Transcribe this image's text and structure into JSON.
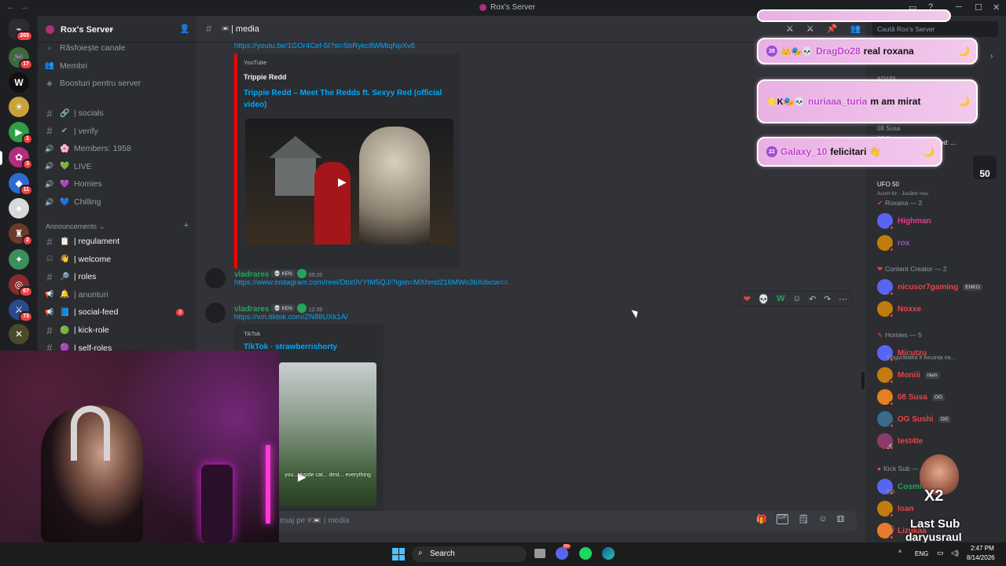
{
  "title_bar": {
    "server_title": "Rox's Server",
    "back_arrow": "←",
    "forward_arrow": "→",
    "minimize": "─",
    "maximize": "☐",
    "close": "✕"
  },
  "rail": {
    "servers": [
      {
        "name": "Discord home",
        "badge": "265",
        "color": "#2b2d31",
        "glyph": "⌁"
      },
      {
        "name": "Server 1",
        "badge": "17",
        "color": "#3b6b3b",
        "glyph": "🎮"
      },
      {
        "name": "Server W",
        "badge": "",
        "color": "#111111",
        "glyph": "W"
      },
      {
        "name": "Server 3",
        "badge": "",
        "color": "#c9a23a",
        "glyph": "☀"
      },
      {
        "name": "Server 4",
        "badge": "1",
        "color": "#2f9e44",
        "glyph": "▶"
      },
      {
        "name": "Rox's Server",
        "badge": "3",
        "color": "#b02e7b",
        "glyph": "✿"
      },
      {
        "name": "Server 6",
        "badge": "11",
        "color": "#2e6bd1",
        "glyph": "◆"
      },
      {
        "name": "Server 7",
        "badge": "",
        "color": "#d9d9d9",
        "glyph": "●"
      },
      {
        "name": "Server 8",
        "badge": "2",
        "color": "#6b3b2a",
        "glyph": "♜"
      },
      {
        "name": "Server 9",
        "badge": "",
        "color": "#3c8f5a",
        "glyph": "✦"
      },
      {
        "name": "Server 10",
        "badge": "67",
        "color": "#8a2a2a",
        "glyph": "◎"
      },
      {
        "name": "Server 11",
        "badge": "73",
        "color": "#2a4a8a",
        "glyph": "⚔"
      },
      {
        "name": "Server 12",
        "badge": "",
        "color": "#4a4a2a",
        "glyph": "✕"
      }
    ]
  },
  "sidebar": {
    "server_name": "Rox's Server",
    "top_items": [
      {
        "icon": "⌕",
        "label": "Răsfoiește canale"
      },
      {
        "icon": "👥",
        "label": "Membri"
      },
      {
        "icon": "◈",
        "label": "Boosturi pentru server"
      }
    ],
    "channels_top": [
      {
        "prefix": "#",
        "emoji": "🔗",
        "label": "| socials",
        "bold": false
      },
      {
        "prefix": "#",
        "emoji": "✔",
        "label": "| verify",
        "bold": false
      },
      {
        "prefix": "🔊",
        "emoji": "🌸",
        "label": "Members: 1958",
        "bold": false
      },
      {
        "prefix": "🔊",
        "emoji": "💚",
        "label": "LIVE",
        "bold": false
      },
      {
        "prefix": "🔊",
        "emoji": "💜",
        "label": "Homies",
        "bold": false
      },
      {
        "prefix": "🔊",
        "emoji": "💙",
        "label": "Chilling",
        "bold": false
      }
    ],
    "category": "Announcements",
    "category_add": "+",
    "channels_ann": [
      {
        "prefix": "#",
        "emoji": "📋",
        "label": "| regulament",
        "bold": true,
        "unread": ""
      },
      {
        "prefix": "☑",
        "emoji": "👋",
        "label": "| welcome",
        "bold": true,
        "unread": ""
      },
      {
        "prefix": "#",
        "emoji": "🔎",
        "label": "| roles",
        "bold": true,
        "unread": ""
      },
      {
        "prefix": "📢",
        "emoji": "🔔",
        "label": "| anunturi",
        "bold": false,
        "unread": ""
      },
      {
        "prefix": "📢",
        "emoji": "📘",
        "label": "| social-feed",
        "bold": true,
        "unread": "3"
      },
      {
        "prefix": "#",
        "emoji": "🟢",
        "label": "| kick-role",
        "bold": true,
        "unread": ""
      },
      {
        "prefix": "#",
        "emoji": "🟣",
        "label": "| self-roles",
        "bold": true,
        "unread": ""
      }
    ]
  },
  "chat": {
    "channel_name": "| media",
    "channel_emoji": "📼",
    "msg0_link": "https://youtu.be/1GOr4Cef-5I?si=5bRykc8WMtqNpXv8",
    "embed1": {
      "provider": "YouTube",
      "author": "Trippie Redd",
      "title": "Trippie Redd – Meet The Redds ft. Sexyy Red (official video)",
      "color": "#ff0000"
    },
    "messages": [
      {
        "user": "vladrares",
        "tag": "💀 KEN",
        "time": "09:20",
        "link": "https://www.instagram.com/reel/Dbz0VYtM5QJ/?igsh=MXhmd216MWo3bXdxcw=="
      },
      {
        "user": "vladrares",
        "tag": "💀 KEN",
        "time": "12:35",
        "link": "https://vm.tiktok.com/ZN88UXk1A/"
      }
    ],
    "embed2": {
      "provider": "TikTok",
      "title": "TikTok · strawberrishorty",
      "video_caption": "you... inside cat... dest... everything"
    },
    "reactions": [
      "❤",
      "💀",
      "W",
      "☺",
      "↶",
      "↷",
      "⋯"
    ],
    "composer_placeholder": "esaj pe #📼 | media",
    "composer_icons": [
      "🎁",
      "GIF",
      "🗒",
      "☺",
      "⚅"
    ]
  },
  "members": {
    "search_placeholder": "Caută Rox's Server",
    "activity": [
      {
        "name": "azxuta",
        "status": "",
        "time": ""
      },
      {
        "name": "Marzy Star",
        "status": "Singurătatea esta",
        "time": ""
      },
      {
        "name": "08 Susa",
        "status": "Scribblenauts Unmasked: ...",
        "time": "Acum 1h · Jucător nou"
      },
      {
        "name": "08 Susa",
        "status": "UFO 50",
        "time": "Acum 6z · Jucător nou"
      }
    ],
    "ufo_badge": "50",
    "groups": [
      {
        "title": "Roxana — 2",
        "icon": "✔",
        "items": [
          {
            "name": "Highman",
            "color": "#e03d8b",
            "tag": "",
            "sub": ""
          },
          {
            "name": "rox",
            "color": "#9b59b6",
            "tag": "",
            "sub": ""
          }
        ]
      },
      {
        "title": "Content Creator — 2",
        "icon": "❤",
        "items": [
          {
            "name": "nicusor7gaming",
            "color": "#ed4245",
            "tag": "ENKO",
            "sub": ""
          },
          {
            "name": "Noxxe",
            "color": "#ed4245",
            "tag": "",
            "sub": ""
          }
        ]
      },
      {
        "title": "Homies — 5",
        "icon": "✎",
        "items": [
          {
            "name": "Micutzu",
            "color": "#ed4245",
            "tag": "",
            "sub": "Singurătatea e locuința na..."
          },
          {
            "name": "Moniii",
            "color": "#ed4245",
            "tag": "ravn",
            "sub": ""
          },
          {
            "name": "08 Susa",
            "color": "#ed4245",
            "tag": "OG",
            "sub": ""
          },
          {
            "name": "OG Sushi",
            "color": "#ed4245",
            "tag": "OG",
            "sub": ""
          },
          {
            "name": "test4te",
            "color": "#ed4245",
            "tag": "",
            "sub": "🚀"
          }
        ]
      },
      {
        "title": "Kick Sub —",
        "icon": "●",
        "items": [
          {
            "name": "Cosmi",
            "color": "#23a55a",
            "tag": "",
            "sub": "kys"
          },
          {
            "name": "Ioan",
            "color": "#ed4245",
            "tag": "",
            "sub": ""
          },
          {
            "name": "Lizukaa",
            "color": "#ed4245",
            "tag": "",
            "sub": ""
          }
        ]
      }
    ]
  },
  "overlay": {
    "icons_row": [
      "⚔",
      "⚔",
      "📌",
      "👥"
    ],
    "messages": [
      {
        "level": "28",
        "badges": "👑🎭💀",
        "name": "DragDo28",
        "text": "real roxana",
        "moon": "🌙"
      },
      {
        "level": "",
        "badges": "🌟K🎭💀",
        "name": "nuriaaa_turia",
        "text": "m am mirat",
        "moon": "🌙"
      },
      {
        "level": "22",
        "badges": "",
        "name": "Galaxy_10",
        "text": "felicitari 👋",
        "moon": "🌙"
      }
    ],
    "sub_alert": {
      "multiplier": "X2",
      "title": "Last Sub",
      "user": "daryusraul"
    }
  },
  "taskbar": {
    "search": "Search",
    "lang": "ENG",
    "time": "2:47 PM",
    "date": "8/14/2026",
    "badge": "99+"
  }
}
